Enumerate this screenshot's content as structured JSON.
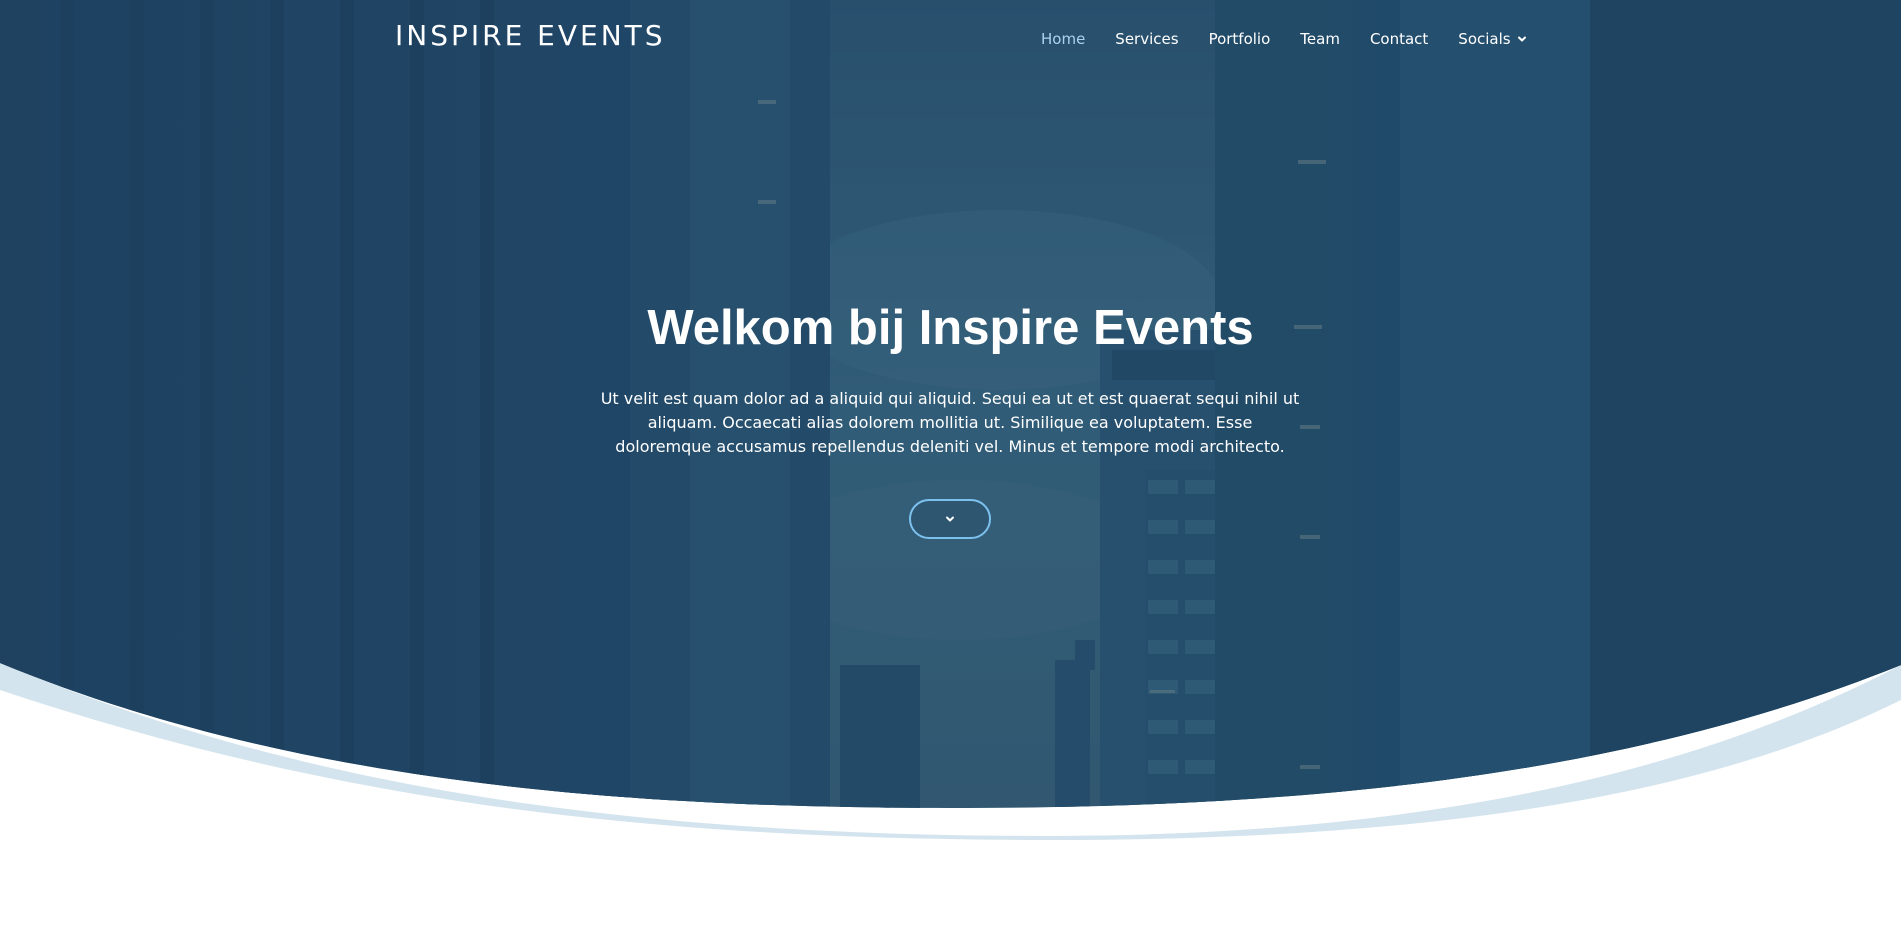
{
  "header": {
    "logo": "INSPIRE EVENTS",
    "nav": [
      {
        "label": "Home",
        "active": true
      },
      {
        "label": "Services",
        "active": false
      },
      {
        "label": "Portfolio",
        "active": false
      },
      {
        "label": "Team",
        "active": false
      },
      {
        "label": "Contact",
        "active": false
      },
      {
        "label": "Socials",
        "active": false,
        "has_dropdown": true
      }
    ]
  },
  "hero": {
    "title": "Welkom bij Inspire Events",
    "text": "Ut velit est quam dolor ad a aliquid qui aliquid. Sequi ea ut et est quaerat sequi nihil ut aliquam. Occaecati alias dolorem mollitia ut. Similique ea voluptatem. Esse doloremque accusamus repellendus deleniti vel. Minus et tempore modi architecto.",
    "scroll_button_icon": "chevron-down-icon"
  },
  "colors": {
    "overlay": "#1e4262",
    "wave_light": "#d3e4ee",
    "nav_active": "#a9d3ef",
    "button_border": "#7cc1ee"
  }
}
